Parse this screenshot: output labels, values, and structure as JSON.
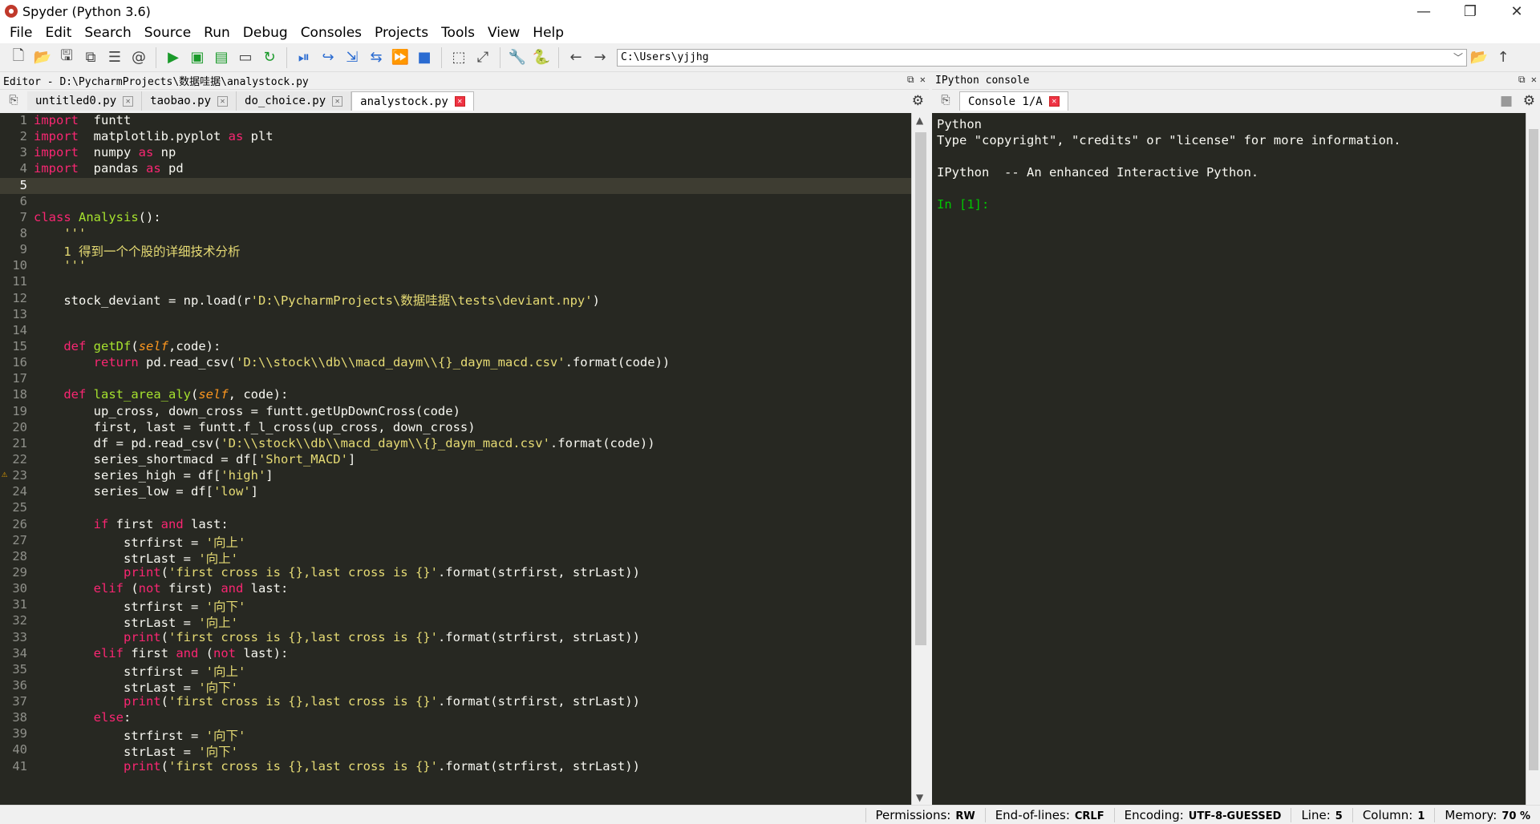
{
  "window": {
    "title": "Spyder (Python 3.6)",
    "minimize": "—",
    "restore": "❐",
    "close": "✕"
  },
  "menu": [
    "File",
    "Edit",
    "Search",
    "Source",
    "Run",
    "Debug",
    "Consoles",
    "Projects",
    "Tools",
    "View",
    "Help"
  ],
  "toolbar": {
    "path": "C:\\Users\\yjjhg"
  },
  "editor": {
    "header": "Editor - D:\\PycharmProjects\\数据哇据\\analystock.py",
    "tabs": [
      "untitled0.py",
      "taobao.py",
      "do_choice.py",
      "analystock.py"
    ],
    "active_tab": 3,
    "current_line": 5,
    "warning_line": 23
  },
  "console": {
    "header": "IPython console",
    "tab": "Console 1/A",
    "lines": [
      "Python",
      "Type \"copyright\", \"credits\" or \"license\" for more information.",
      "",
      "IPython  -- An enhanced Interactive Python.",
      ""
    ],
    "prompt": "In [1]:"
  },
  "status": {
    "permissions_label": "Permissions:",
    "permissions": "RW",
    "eol_label": "End-of-lines:",
    "eol": "CRLF",
    "encoding_label": "Encoding:",
    "encoding": "UTF-8-GUESSED",
    "line_label": "Line:",
    "line": "5",
    "column_label": "Column:",
    "column": "1",
    "memory_label": "Memory:",
    "memory": "70 %"
  },
  "code": [
    [
      [
        "kw",
        "import"
      ],
      [
        "",
        "  funtt"
      ]
    ],
    [
      [
        "kw",
        "import"
      ],
      [
        "",
        "  matplotlib.pyplot "
      ],
      [
        "kw",
        "as"
      ],
      [
        "",
        " plt"
      ]
    ],
    [
      [
        "kw",
        "import"
      ],
      [
        "",
        "  numpy "
      ],
      [
        "kw",
        "as"
      ],
      [
        "",
        " np"
      ]
    ],
    [
      [
        "kw",
        "import"
      ],
      [
        "",
        "  pandas "
      ],
      [
        "kw",
        "as"
      ],
      [
        "",
        " pd"
      ]
    ],
    [],
    [],
    [
      [
        "kw",
        "class"
      ],
      [
        "",
        " "
      ],
      [
        "cls",
        "Analysis"
      ],
      [
        "",
        "():"
      ]
    ],
    [
      [
        "ks",
        "    '''"
      ]
    ],
    [
      [
        "ks",
        "    1 得到一个个股的详细技术分析"
      ]
    ],
    [
      [
        "ks",
        "    '''"
      ]
    ],
    [],
    [
      [
        "",
        "    stock_deviant = np.load(r"
      ],
      [
        "ks",
        "'D:\\PycharmProjects\\数据哇据\\tests\\deviant.npy'"
      ],
      [
        "",
        ")"
      ]
    ],
    [],
    [],
    [
      [
        "",
        "    "
      ],
      [
        "kw",
        "def"
      ],
      [
        "",
        " "
      ],
      [
        "cls",
        "getDf"
      ],
      [
        "",
        "("
      ],
      [
        "slf",
        "self"
      ],
      [
        "",
        ",code):"
      ]
    ],
    [
      [
        "",
        "        "
      ],
      [
        "kw",
        "return"
      ],
      [
        "",
        " pd.read_csv("
      ],
      [
        "ks",
        "'D:\\\\stock\\\\db\\\\macd_daym\\\\{}_daym_macd.csv'"
      ],
      [
        "",
        ".format(code))"
      ]
    ],
    [],
    [
      [
        "",
        "    "
      ],
      [
        "kw",
        "def"
      ],
      [
        "",
        " "
      ],
      [
        "cls",
        "last_area_aly"
      ],
      [
        "",
        "("
      ],
      [
        "slf",
        "self"
      ],
      [
        "",
        ", code):"
      ]
    ],
    [
      [
        "",
        "        up_cross, down_cross = funtt.getUpDownCross(code)"
      ]
    ],
    [
      [
        "",
        "        first, last = funtt.f_l_cross(up_cross, down_cross)"
      ]
    ],
    [
      [
        "",
        "        df = pd.read_csv("
      ],
      [
        "ks",
        "'D:\\\\stock\\\\db\\\\macd_daym\\\\{}_daym_macd.csv'"
      ],
      [
        "",
        ".format(code))"
      ]
    ],
    [
      [
        "",
        "        series_shortmacd = df["
      ],
      [
        "ks",
        "'Short_MACD'"
      ],
      [
        "",
        "]"
      ]
    ],
    [
      [
        "",
        "        series_high = df["
      ],
      [
        "ks",
        "'high'"
      ],
      [
        "",
        "]"
      ]
    ],
    [
      [
        "",
        "        series_low = df["
      ],
      [
        "ks",
        "'low'"
      ],
      [
        "",
        "]"
      ]
    ],
    [],
    [
      [
        "",
        "        "
      ],
      [
        "kw",
        "if"
      ],
      [
        "",
        " first "
      ],
      [
        "kw",
        "and"
      ],
      [
        "",
        " last:"
      ]
    ],
    [
      [
        "",
        "            strfirst = "
      ],
      [
        "ks",
        "'向上'"
      ]
    ],
    [
      [
        "",
        "            strLast = "
      ],
      [
        "ks",
        "'向上'"
      ]
    ],
    [
      [
        "",
        "            "
      ],
      [
        "kw",
        "print"
      ],
      [
        "",
        "("
      ],
      [
        "ks",
        "'first cross is {},last cross is {}'"
      ],
      [
        "",
        ".format(strfirst, strLast))"
      ]
    ],
    [
      [
        "",
        "        "
      ],
      [
        "kw",
        "elif"
      ],
      [
        "",
        " ("
      ],
      [
        "kw",
        "not"
      ],
      [
        "",
        " first) "
      ],
      [
        "kw",
        "and"
      ],
      [
        "",
        " last:"
      ]
    ],
    [
      [
        "",
        "            strfirst = "
      ],
      [
        "ks",
        "'向下'"
      ]
    ],
    [
      [
        "",
        "            strLast = "
      ],
      [
        "ks",
        "'向上'"
      ]
    ],
    [
      [
        "",
        "            "
      ],
      [
        "kw",
        "print"
      ],
      [
        "",
        "("
      ],
      [
        "ks",
        "'first cross is {},last cross is {}'"
      ],
      [
        "",
        ".format(strfirst, strLast))"
      ]
    ],
    [
      [
        "",
        "        "
      ],
      [
        "kw",
        "elif"
      ],
      [
        "",
        " first "
      ],
      [
        "kw",
        "and"
      ],
      [
        "",
        " ("
      ],
      [
        "kw",
        "not"
      ],
      [
        "",
        " last):"
      ]
    ],
    [
      [
        "",
        "            strfirst = "
      ],
      [
        "ks",
        "'向上'"
      ]
    ],
    [
      [
        "",
        "            strLast = "
      ],
      [
        "ks",
        "'向下'"
      ]
    ],
    [
      [
        "",
        "            "
      ],
      [
        "kw",
        "print"
      ],
      [
        "",
        "("
      ],
      [
        "ks",
        "'first cross is {},last cross is {}'"
      ],
      [
        "",
        ".format(strfirst, strLast))"
      ]
    ],
    [
      [
        "",
        "        "
      ],
      [
        "kw",
        "else"
      ],
      [
        "",
        ":"
      ]
    ],
    [
      [
        "",
        "            strfirst = "
      ],
      [
        "ks",
        "'向下'"
      ]
    ],
    [
      [
        "",
        "            strLast = "
      ],
      [
        "ks",
        "'向下'"
      ]
    ],
    [
      [
        "",
        "            "
      ],
      [
        "kw",
        "print"
      ],
      [
        "",
        "("
      ],
      [
        "ks",
        "'first cross is {},last cross is {}'"
      ],
      [
        "",
        ".format(strfirst, strLast))"
      ]
    ]
  ]
}
